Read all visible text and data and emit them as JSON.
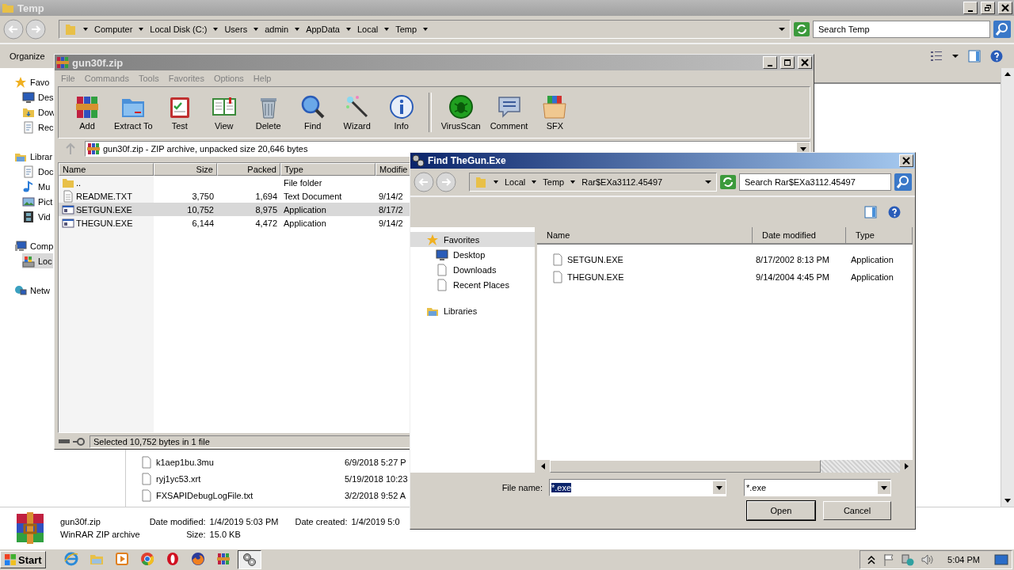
{
  "explorer": {
    "title": "Temp",
    "breadcrumbs": [
      "Computer",
      "Local Disk (C:)",
      "Users",
      "admin",
      "AppData",
      "Local",
      "Temp"
    ],
    "search": {
      "placeholder": "Search Temp"
    },
    "toolbar": [
      "Organize"
    ],
    "nav": [
      {
        "label": "Favo",
        "selected": false,
        "children": [
          {
            "label": "Des",
            "selected": false
          },
          {
            "label": "Dow",
            "selected": false
          },
          {
            "label": "Rec",
            "selected": false
          }
        ]
      },
      {
        "label": "Librar",
        "selected": false,
        "children": [
          {
            "label": "Doc",
            "selected": false
          },
          {
            "label": "Mu",
            "selected": false
          },
          {
            "label": "Pict",
            "selected": false
          },
          {
            "label": "Vid",
            "selected": false
          }
        ]
      },
      {
        "label": "Comp",
        "selected": false,
        "children": [
          {
            "label": "Loc",
            "selected": true
          }
        ]
      },
      {
        "label": "Netw",
        "selected": false
      }
    ],
    "files": [
      {
        "name": "k1aep1bu.3mu",
        "date": "6/9/2018 5:27 P"
      },
      {
        "name": "ryj1yc53.xrt",
        "date": "5/19/2018 10:23"
      },
      {
        "name": "FXSAPIDebugLogFile.txt",
        "date": "3/2/2018 9:52 A"
      }
    ],
    "details": {
      "name": "gun30f.zip",
      "type": "WinRAR ZIP archive",
      "fields": [
        {
          "label": "Date modified:",
          "value": "1/4/2019 5:03 PM"
        },
        {
          "label": "Date created:",
          "value": "1/4/2019 5:0"
        },
        {
          "label": "Size:",
          "value": "15.0 KB"
        }
      ]
    }
  },
  "winrar": {
    "title": "gun30f.zip",
    "menu": [
      "File",
      "Commands",
      "Tools",
      "Favorites",
      "Options",
      "Help"
    ],
    "toolbar": [
      "Add",
      "Extract To",
      "Test",
      "View",
      "Delete",
      "Find",
      "Wizard",
      "Info",
      "VirusScan",
      "Comment",
      "SFX"
    ],
    "path": "gun30f.zip - ZIP archive, unpacked size 20,646 bytes",
    "columns": [
      "Name",
      "Size",
      "Packed",
      "Type",
      "Modifie"
    ],
    "rows": [
      {
        "kind": "folder",
        "name": "..",
        "size": "",
        "packed": "",
        "type": "File folder",
        "modified": "",
        "selected": false
      },
      {
        "kind": "document",
        "name": "README.TXT",
        "size": "3,750",
        "packed": "1,694",
        "type": "Text Document",
        "modified": "9/14/2",
        "selected": false
      },
      {
        "kind": "application",
        "name": "SETGUN.EXE",
        "size": "10,752",
        "packed": "8,975",
        "type": "Application",
        "modified": "8/17/2",
        "selected": true
      },
      {
        "kind": "application",
        "name": "THEGUN.EXE",
        "size": "6,144",
        "packed": "4,472",
        "type": "Application",
        "modified": "9/14/2",
        "selected": false
      }
    ],
    "status": "Selected 10,752 bytes in 1 file"
  },
  "dialog": {
    "title": "Find TheGun.Exe",
    "breadcrumbs": [
      "Local",
      "Temp",
      "Rar$EXa3112.45497"
    ],
    "search": {
      "placeholder": "Search Rar$EXa3112.45497"
    },
    "nav": [
      {
        "label": "Favorites",
        "selected": true,
        "children": [
          {
            "label": "Desktop",
            "selected": false
          },
          {
            "label": "Downloads",
            "selected": false
          },
          {
            "label": "Recent Places",
            "selected": false
          }
        ]
      },
      {
        "label": "Libraries",
        "selected": false
      }
    ],
    "columns": [
      "Name",
      "Date modified",
      "Type"
    ],
    "files": [
      {
        "name": "SETGUN.EXE",
        "date": "8/17/2002 8:13 PM",
        "type": "Application"
      },
      {
        "name": "THEGUN.EXE",
        "date": "9/14/2004 4:45 PM",
        "type": "Application"
      }
    ],
    "file_name": {
      "label": "File name:",
      "value": "*.exe",
      "text_selected": true
    },
    "filter": "*.exe",
    "buttons": [
      "Open",
      "Cancel"
    ]
  },
  "taskbar": {
    "start": "Start",
    "apps": [
      {
        "active": false
      },
      {
        "active": false
      },
      {
        "active": false
      },
      {
        "active": false
      },
      {
        "active": false
      },
      {
        "active": false
      },
      {
        "active": false
      },
      {
        "active": true
      }
    ],
    "clock": "5:04 PM"
  }
}
